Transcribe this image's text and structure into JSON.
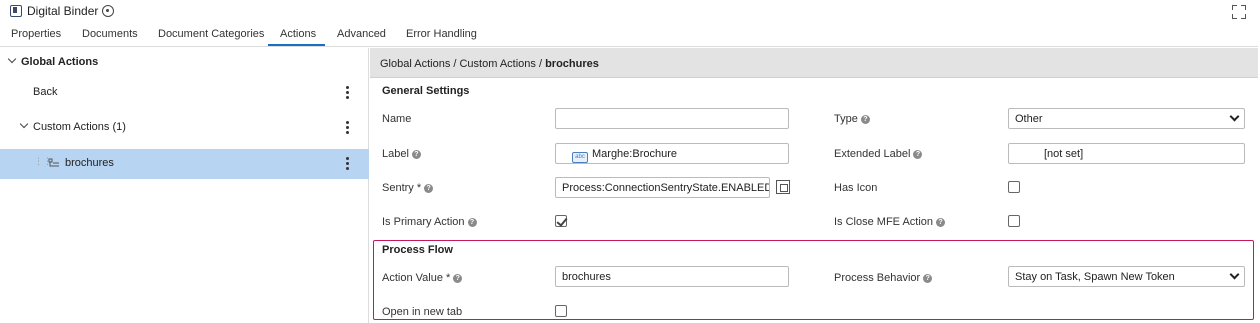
{
  "app": {
    "title": "Digital Binder"
  },
  "tabs": [
    {
      "label": "Properties"
    },
    {
      "label": "Documents"
    },
    {
      "label": "Document Categories"
    },
    {
      "label": "Actions"
    },
    {
      "label": "Advanced"
    },
    {
      "label": "Error Handling"
    }
  ],
  "active_tab": "Actions",
  "tree": {
    "root": "Global Actions",
    "items": [
      {
        "label": "Back"
      },
      {
        "label": "Custom Actions (1)"
      },
      {
        "label": "brochures"
      }
    ]
  },
  "breadcrumb": {
    "path": "Global Actions / Custom Actions / ",
    "current": "brochures"
  },
  "general": {
    "title": "General Settings",
    "name_label": "Name",
    "name_value": "",
    "label_label": "Label",
    "label_icon": "abc",
    "label_value": "Marghe:Brochure",
    "sentry_label": "Sentry *",
    "sentry_value": "Process:ConnectionSentryState.ENABLED()",
    "primary_label": "Is Primary Action",
    "primary_checked": true,
    "type_label": "Type",
    "type_value": "Other",
    "extended_label": "Extended Label",
    "extended_value": "[not set]",
    "has_icon_label": "Has Icon",
    "has_icon_checked": false,
    "close_mfe_label": "Is Close MFE Action",
    "close_mfe_checked": false
  },
  "process_flow": {
    "title": "Process Flow",
    "action_value_label": "Action Value *",
    "action_value": "brochures",
    "new_tab_label": "Open in new tab",
    "new_tab_checked": false,
    "behavior_label": "Process Behavior",
    "behavior_value": "Stay on Task, Spawn New Token"
  },
  "colors": {
    "accent": "#1a6fc4",
    "selected_row": "#b7d5f2",
    "highlight_border": "#c4185d"
  },
  "icons": [
    "app-icon",
    "crosshair-icon",
    "expand-icon",
    "chevron-down-icon",
    "kebab-menu-icon",
    "drag-handle-icon",
    "action-icon",
    "help-icon",
    "expression-editor-icon"
  ]
}
